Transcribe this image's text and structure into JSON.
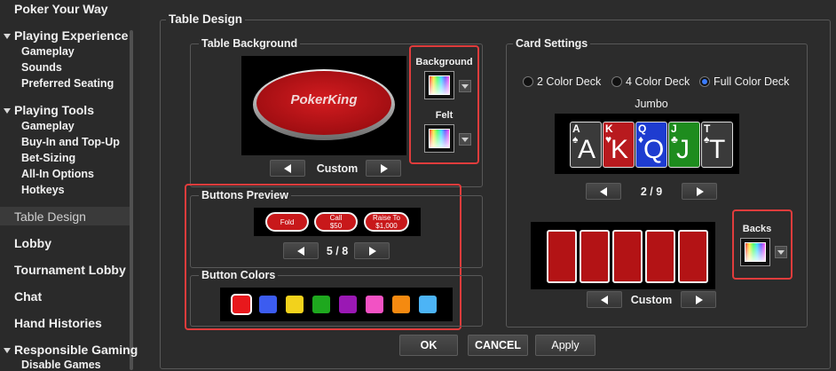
{
  "sidebar": {
    "top_item": "Poker Your Way",
    "playing_experience": {
      "label": "Playing Experience",
      "items": [
        "Gameplay",
        "Sounds",
        "Preferred Seating"
      ]
    },
    "playing_tools": {
      "label": "Playing Tools",
      "items": [
        "Gameplay",
        "Buy-In and Top-Up",
        "Bet-Sizing",
        "All-In Options",
        "Hotkeys"
      ]
    },
    "table_design": "Table Design",
    "lobby": "Lobby",
    "tournament_lobby": "Tournament Lobby",
    "chat": "Chat",
    "hand_histories": "Hand Histories",
    "responsible_gaming": {
      "label": "Responsible Gaming",
      "items": [
        "Disable Games"
      ]
    }
  },
  "main": {
    "title": "Table Design",
    "table_background": {
      "title": "Table Background",
      "logo_text": "PokerKing",
      "style_label": "Custom",
      "background_label": "Background",
      "felt_label": "Felt"
    },
    "buttons_preview": {
      "title": "Buttons Preview",
      "buttons": [
        {
          "line1": "Fold",
          "line2": ""
        },
        {
          "line1": "Call",
          "line2": "$50"
        },
        {
          "line1": "Raise To",
          "line2": "$1,000"
        }
      ],
      "page": "5 / 8"
    },
    "button_colors": {
      "title": "Button Colors",
      "colors": [
        "#e8181c",
        "#3c5cf0",
        "#f2d21c",
        "#1ea81e",
        "#9a18b4",
        "#f252c4",
        "#f58a10",
        "#4cb4f6"
      ]
    },
    "card_settings": {
      "title": "Card Settings",
      "deck_options": [
        "2 Color Deck",
        "4 Color Deck",
        "Full Color Deck"
      ],
      "selected_deck": "Full Color Deck",
      "size_label": "Jumbo",
      "cards": [
        {
          "rank": "A",
          "suit": "♠",
          "color": "#3a3a3a"
        },
        {
          "rank": "K",
          "suit": "♥",
          "color": "#b81a1e"
        },
        {
          "rank": "Q",
          "suit": "♦",
          "color": "#1e3cd0"
        },
        {
          "rank": "J",
          "suit": "♣",
          "color": "#1e8c1e"
        },
        {
          "rank": "T",
          "suit": "♠",
          "color": "#3a3a3a"
        }
      ],
      "card_page": "2 / 9",
      "backs_label": "Backs",
      "backs_style": "Custom"
    },
    "actions": {
      "ok": "OK",
      "cancel": "CANCEL",
      "apply": "Apply"
    }
  }
}
